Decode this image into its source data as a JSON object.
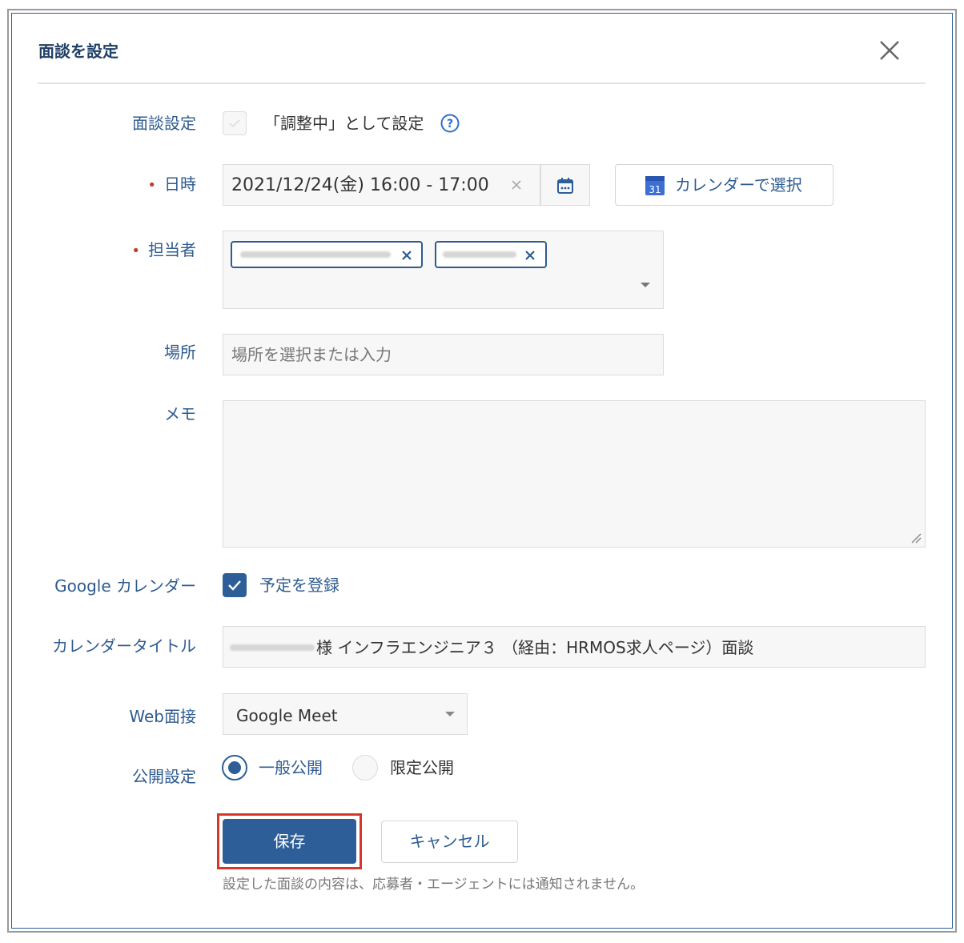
{
  "dialog": {
    "title": "面談を設定"
  },
  "form": {
    "status": {
      "label": "面談設定",
      "checkbox_text": "「調整中」として設定"
    },
    "datetime": {
      "label": "日時",
      "value": "2021/12/24(金) 16:00 - 17:00",
      "calendar_button": "カレンダーで選択",
      "calendar_icon_day": "31"
    },
    "assignee": {
      "label": "担当者"
    },
    "location": {
      "label": "場所",
      "placeholder": "場所を選択または入力"
    },
    "memo": {
      "label": "メモ"
    },
    "google_calendar": {
      "label": "Google カレンダー",
      "checkbox_text": "予定を登録"
    },
    "calendar_title": {
      "label": "カレンダータイトル",
      "value_suffix": "様 インフラエンジニア３ （経由：HRMOS求人ページ）面談"
    },
    "web_interview": {
      "label": "Web面接",
      "value": "Google Meet"
    },
    "visibility": {
      "label": "公開設定",
      "options": [
        "一般公開",
        "限定公開"
      ]
    }
  },
  "actions": {
    "save": "保存",
    "cancel": "キャンセル",
    "note": "設定した面談の内容は、応募者・エージェントには通知されません。"
  },
  "colors": {
    "primary": "#2d5e97",
    "label": "#2e5b8f",
    "highlight": "#d9362b",
    "required": "#c0392b"
  }
}
